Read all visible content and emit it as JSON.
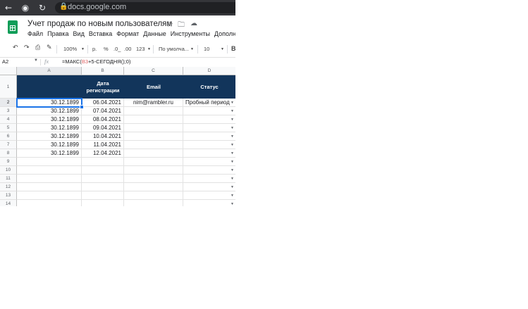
{
  "browser": {
    "url": "docs.google.com"
  },
  "doc": {
    "title": "Учет продаж по новым пользователям"
  },
  "menu": [
    "Файл",
    "Правка",
    "Вид",
    "Вставка",
    "Формат",
    "Данные",
    "Инструменты",
    "Дополн"
  ],
  "toolbar": {
    "zoom": "100%",
    "currency": "р.",
    "percent": "%",
    "dec_less": ".0_",
    "dec_more": ".00",
    "format_more": "123",
    "font": "По умолча...",
    "font_size": "10",
    "bold": "B"
  },
  "formula_bar": {
    "cell_ref": "A2",
    "formula_prefix": "=МАКС(",
    "formula_ref": "B3",
    "formula_suffix": "+5-СЕГОДНЯ();0)"
  },
  "columns": [
    "A",
    "B",
    "C",
    "D"
  ],
  "rows": [
    "1",
    "2",
    "3",
    "4",
    "5",
    "6",
    "7",
    "8",
    "9",
    "10",
    "11",
    "12",
    "13",
    "14"
  ],
  "header_row": {
    "b_line1": "Дата",
    "b_line2": "регистрации",
    "c": "Email",
    "d": "Статус"
  },
  "data_rows": [
    {
      "a": "30.12.1899",
      "b": "06.04.2021",
      "c": "nim@rambler.ru",
      "d": "Пробный период"
    },
    {
      "a": "30.12.1899",
      "b": "07.04.2021",
      "c": "",
      "d": ""
    },
    {
      "a": "30.12.1899",
      "b": "08.04.2021",
      "c": "",
      "d": ""
    },
    {
      "a": "30.12.1899",
      "b": "09.04.2021",
      "c": "",
      "d": ""
    },
    {
      "a": "30.12.1899",
      "b": "10.04.2021",
      "c": "",
      "d": ""
    },
    {
      "a": "30.12.1899",
      "b": "11.04.2021",
      "c": "",
      "d": ""
    },
    {
      "a": "30.12.1899",
      "b": "12.04.2021",
      "c": "",
      "d": ""
    }
  ],
  "colors": {
    "header_bg": "#12355b",
    "selection": "#1a73e8",
    "sheets_green": "#0f9d58"
  }
}
